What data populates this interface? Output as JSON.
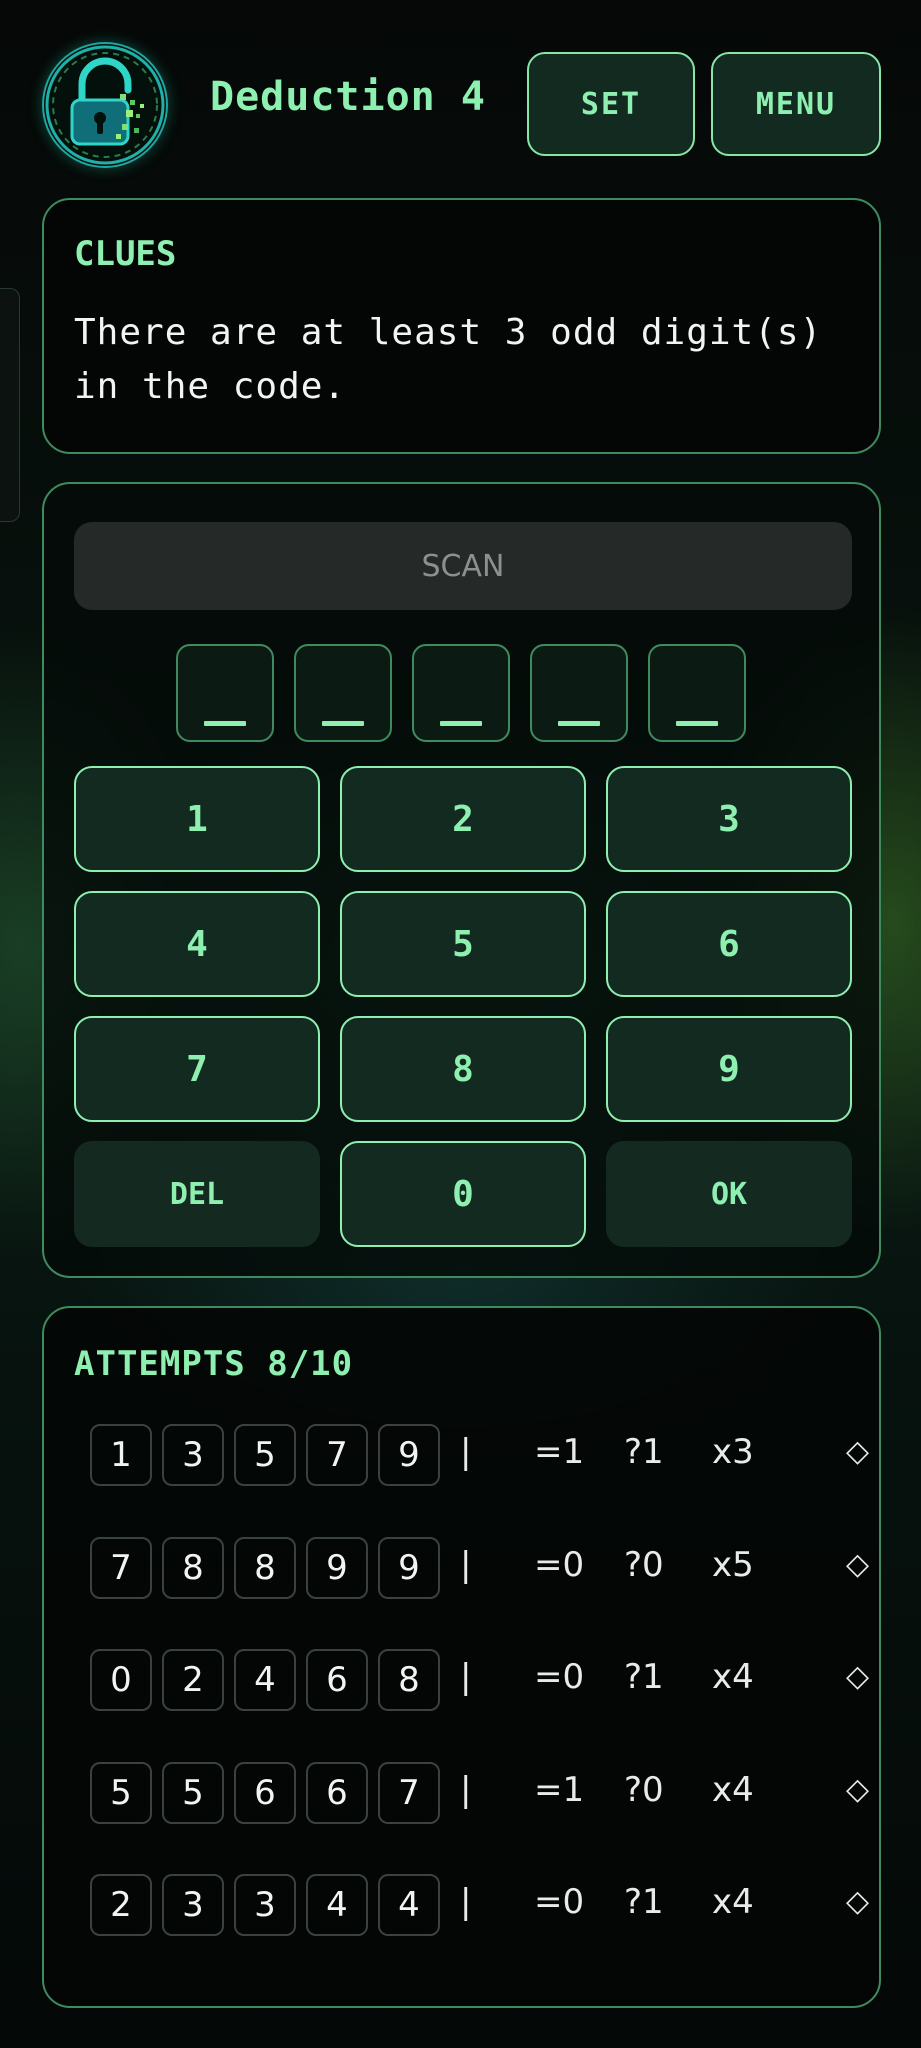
{
  "header": {
    "title": "Deduction 4",
    "set_label": "SET",
    "menu_label": "MENU",
    "logo_icon": "padlock-icon"
  },
  "clues": {
    "title": "CLUES",
    "text": "There are at least 3 odd digit(s) in the code."
  },
  "pad": {
    "scan_label": "SCAN",
    "slots": [
      "",
      "",
      "",
      "",
      ""
    ],
    "keys": [
      "1",
      "2",
      "3",
      "4",
      "5",
      "6",
      "7",
      "8",
      "9"
    ],
    "del_label": "DEL",
    "zero_label": "0",
    "ok_label": "OK"
  },
  "attempts": {
    "title": "ATTEMPTS 8/10",
    "rows": [
      {
        "digits": [
          "1",
          "3",
          "5",
          "7",
          "9"
        ],
        "sep": "|",
        "exact": "=1",
        "partial": "?1",
        "count": "x3",
        "mark": "◇"
      },
      {
        "digits": [
          "7",
          "8",
          "8",
          "9",
          "9"
        ],
        "sep": "|",
        "exact": "=0",
        "partial": "?0",
        "count": "x5",
        "mark": "◇"
      },
      {
        "digits": [
          "0",
          "2",
          "4",
          "6",
          "8"
        ],
        "sep": "|",
        "exact": "=0",
        "partial": "?1",
        "count": "x4",
        "mark": "◇"
      },
      {
        "digits": [
          "5",
          "5",
          "6",
          "6",
          "7"
        ],
        "sep": "|",
        "exact": "=1",
        "partial": "?0",
        "count": "x4",
        "mark": "◇"
      },
      {
        "digits": [
          "2",
          "3",
          "3",
          "4",
          "4"
        ],
        "sep": "|",
        "exact": "=0",
        "partial": "?1",
        "count": "x4",
        "mark": "◇"
      }
    ]
  },
  "colors": {
    "accent": "#8ef0b0",
    "panel_border": "#3f8a5e",
    "button_bg": "#132a20",
    "background": "#050908"
  }
}
